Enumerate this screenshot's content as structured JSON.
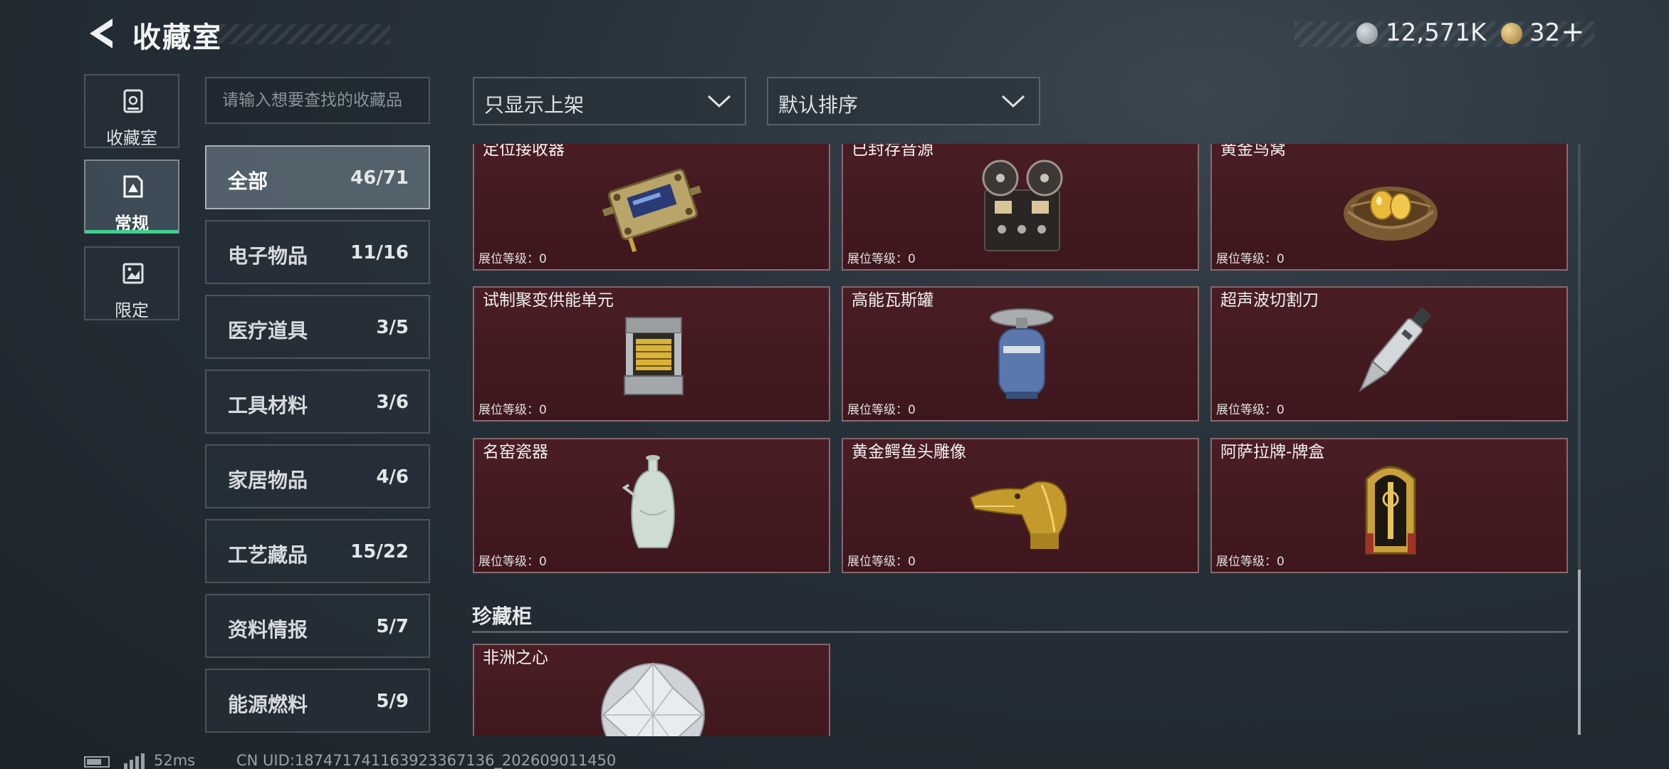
{
  "header": {
    "title": "收藏室",
    "currency_silver": "12,571K",
    "currency_gold": "32",
    "plus_label": "+"
  },
  "sidebar": {
    "tabs": [
      {
        "label": "收藏室",
        "icon": "vault-icon"
      },
      {
        "label": "常规",
        "icon": "display-icon"
      },
      {
        "label": "限定",
        "icon": "picture-icon"
      }
    ],
    "active_index": 1
  },
  "search": {
    "placeholder": "请输入想要查找的收藏品"
  },
  "filters": {
    "display_filter": "只显示上架",
    "sort_order": "默认排序"
  },
  "categories": [
    {
      "name": "全部",
      "count": "46/71"
    },
    {
      "name": "电子物品",
      "count": "11/16"
    },
    {
      "name": "医疗道具",
      "count": "3/5"
    },
    {
      "name": "工具材料",
      "count": "3/6"
    },
    {
      "name": "家居物品",
      "count": "4/6"
    },
    {
      "name": "工艺藏品",
      "count": "15/22"
    },
    {
      "name": "资料情报",
      "count": "5/7"
    },
    {
      "name": "能源燃料",
      "count": "5/9"
    }
  ],
  "items": [
    {
      "name": "定位接收器",
      "level": "展位等级：0",
      "icon": "receiver-icon"
    },
    {
      "name": "已封存音源",
      "level": "展位等级：0",
      "icon": "tape-recorder-icon"
    },
    {
      "name": "黄金鸟窝",
      "level": "展位等级：0",
      "icon": "golden-nest-icon"
    },
    {
      "name": "试制聚变供能单元",
      "level": "展位等级：0",
      "icon": "fusion-unit-icon"
    },
    {
      "name": "高能瓦斯罐",
      "level": "展位等级：0",
      "icon": "gas-tank-icon"
    },
    {
      "name": "超声波切割刀",
      "level": "展位等级：0",
      "icon": "ultrasonic-knife-icon"
    },
    {
      "name": "名窑瓷器",
      "level": "展位等级：0",
      "icon": "porcelain-vase-icon"
    },
    {
      "name": "黄金鳄鱼头雕像",
      "level": "展位等级：0",
      "icon": "gold-crocodile-statue-icon"
    },
    {
      "name": "阿萨拉牌-牌盒",
      "level": "展位等级：0",
      "icon": "card-box-icon"
    }
  ],
  "section": {
    "title": "珍藏柜",
    "items": [
      {
        "name": "非洲之心",
        "icon": "diamond-icon"
      }
    ]
  },
  "footer": {
    "ping": "52ms",
    "uid": "CN UID:187471741163923367136_202609011450"
  }
}
